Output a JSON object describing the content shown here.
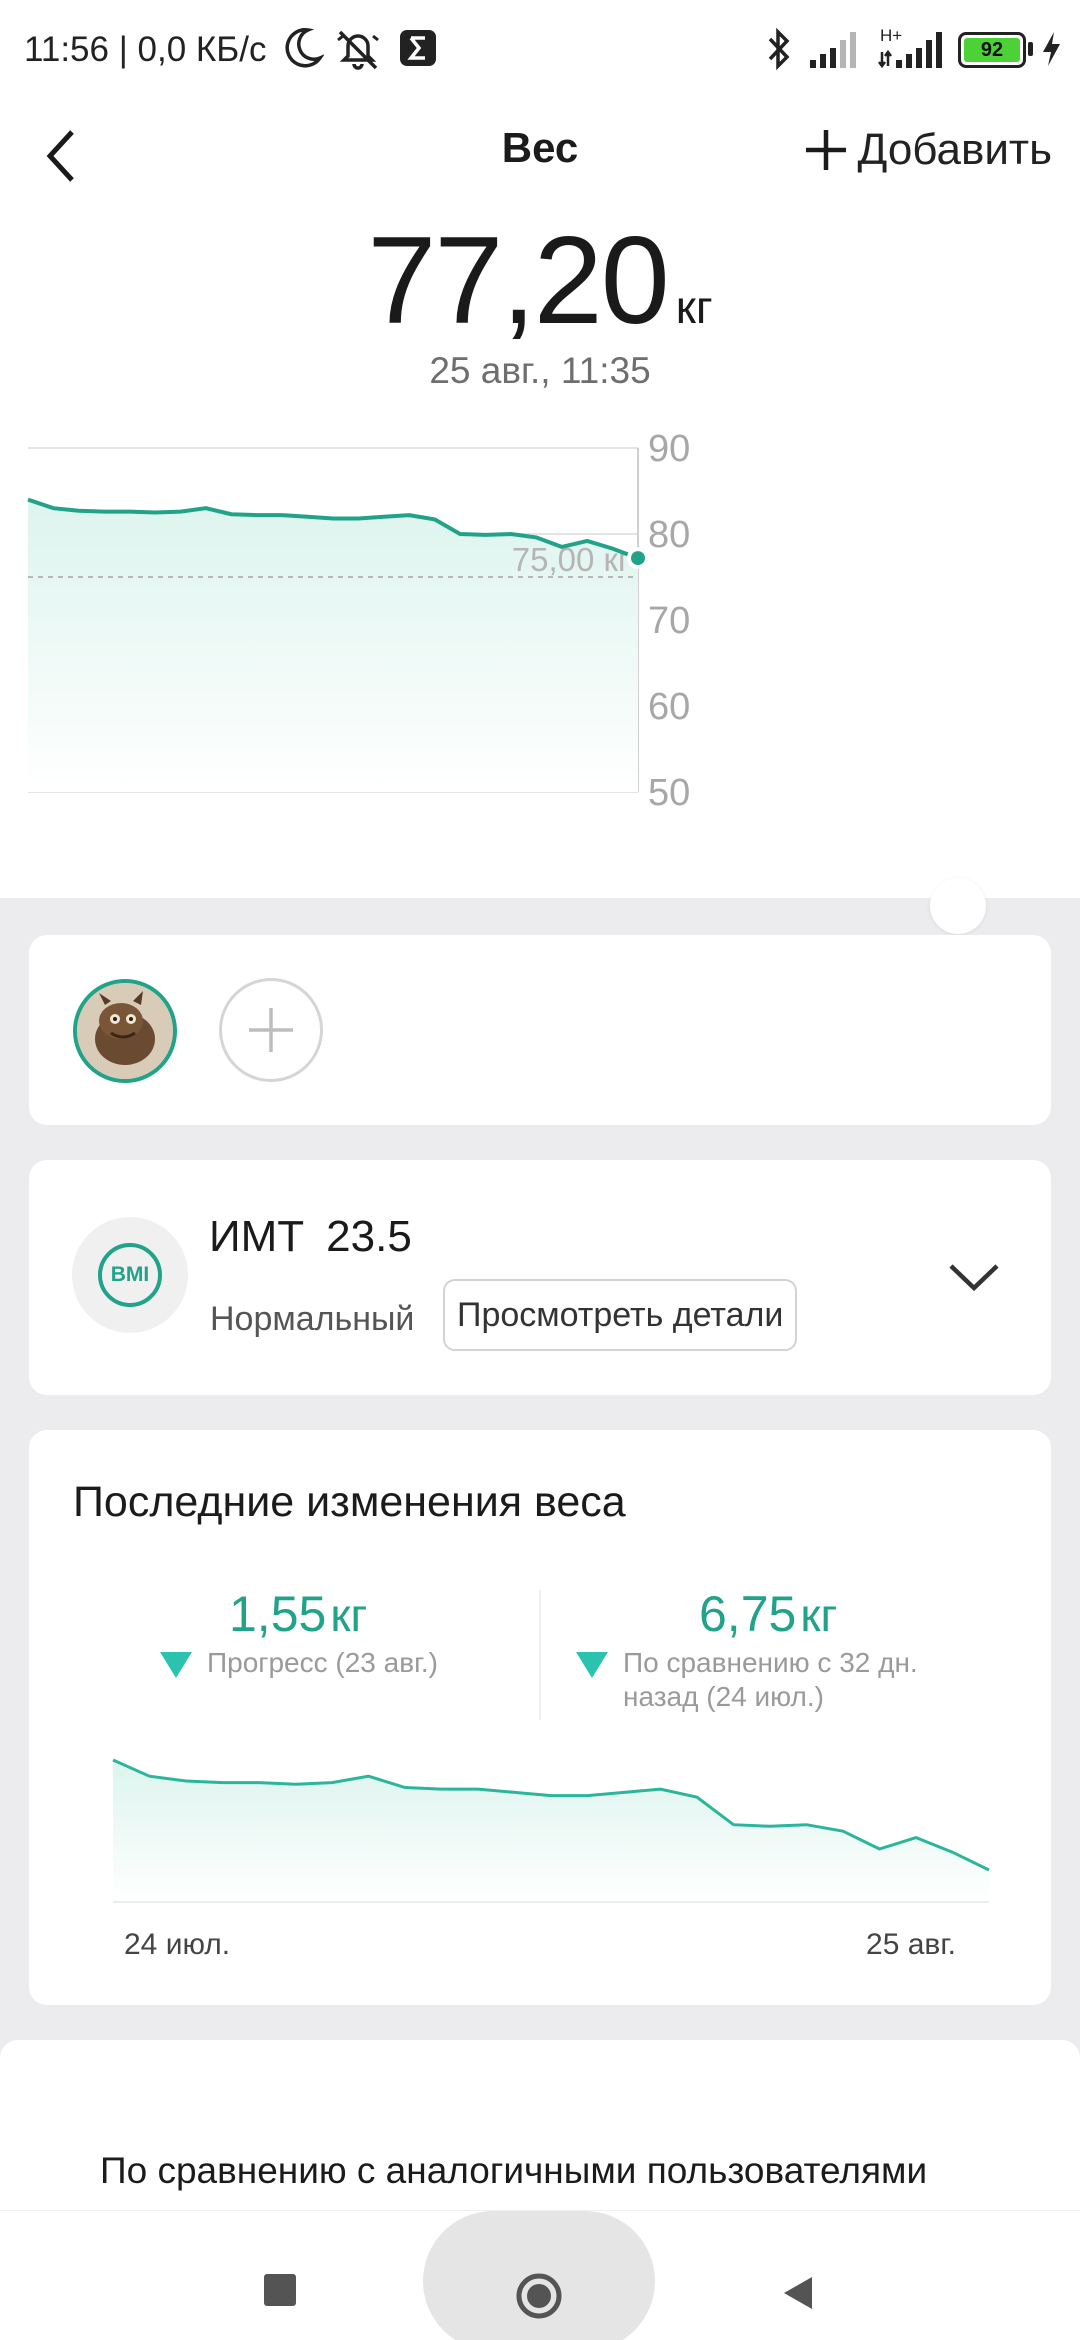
{
  "status_bar": {
    "time_network": "11:56 | 0,0 КБ/с",
    "network_type": "H+",
    "battery": "92",
    "icons": [
      "moon-icon",
      "alarm-off-icon",
      "sigma-app-icon",
      "bluetooth-icon",
      "signal-icon",
      "signal-icon",
      "battery-icon",
      "charging-icon"
    ]
  },
  "header": {
    "title": "Вес",
    "add_label": "Добавить"
  },
  "current": {
    "value": "77,20",
    "unit": "кг",
    "date": "25 авг., 11:35"
  },
  "chart_data": [
    {
      "type": "area",
      "title": "",
      "ylim": [
        50,
        90
      ],
      "y_ticks": [
        "90",
        "80",
        "70",
        "60",
        "50"
      ],
      "axis_side": "right",
      "reference_line": {
        "value": 75,
        "label": "75,00 кг"
      },
      "values": [
        84.0,
        83.0,
        82.7,
        82.6,
        82.6,
        82.5,
        82.6,
        83.0,
        82.3,
        82.2,
        82.2,
        82.0,
        81.8,
        81.8,
        82.0,
        82.2,
        81.7,
        80.0,
        79.9,
        80.0,
        79.6,
        78.5,
        79.2,
        78.3,
        77.2
      ],
      "colors": {
        "line": "#21A38A",
        "fill": "#DDF4EE"
      }
    },
    {
      "type": "area",
      "title": "",
      "x_labels": [
        "24 июл.",
        "25 авг."
      ],
      "values": [
        84.0,
        83.0,
        82.7,
        82.6,
        82.6,
        82.5,
        82.6,
        83.0,
        82.3,
        82.2,
        82.2,
        82.0,
        81.8,
        81.8,
        82.0,
        82.2,
        81.7,
        80.0,
        79.9,
        80.0,
        79.6,
        78.5,
        79.2,
        78.3,
        77.2
      ],
      "colors": {
        "line": "#2AB59C",
        "fill": "#DDF4EE"
      }
    }
  ],
  "users": {
    "avatar_icon": "user-avatar-icon",
    "add_icon": "plus-icon"
  },
  "bmi": {
    "badge": "BMI",
    "label": "ИМТ",
    "value": "23.5",
    "status": "Нормальный",
    "details_label": "Просмотреть детали"
  },
  "changes": {
    "title": "Последние изменения веса",
    "progress": {
      "value": "1,55",
      "unit": "кг",
      "desc": "Прогресс (23 авг.)"
    },
    "compare": {
      "value": "6,75",
      "unit": "кг",
      "desc_line1": "По сравнению с 32 дн.",
      "desc_line2": "назад (24 июл.)"
    },
    "date_start": "24 июл.",
    "date_end": "25 авг."
  },
  "comparison": {
    "text": "По сравнению с аналогичными пользователями"
  },
  "nav": {
    "icons": [
      "recent-apps-icon",
      "home-icon",
      "back-icon"
    ]
  },
  "colors": {
    "accent": "#21A38A",
    "accent_light": "#2BC3B0",
    "background": "#ECECEF"
  }
}
